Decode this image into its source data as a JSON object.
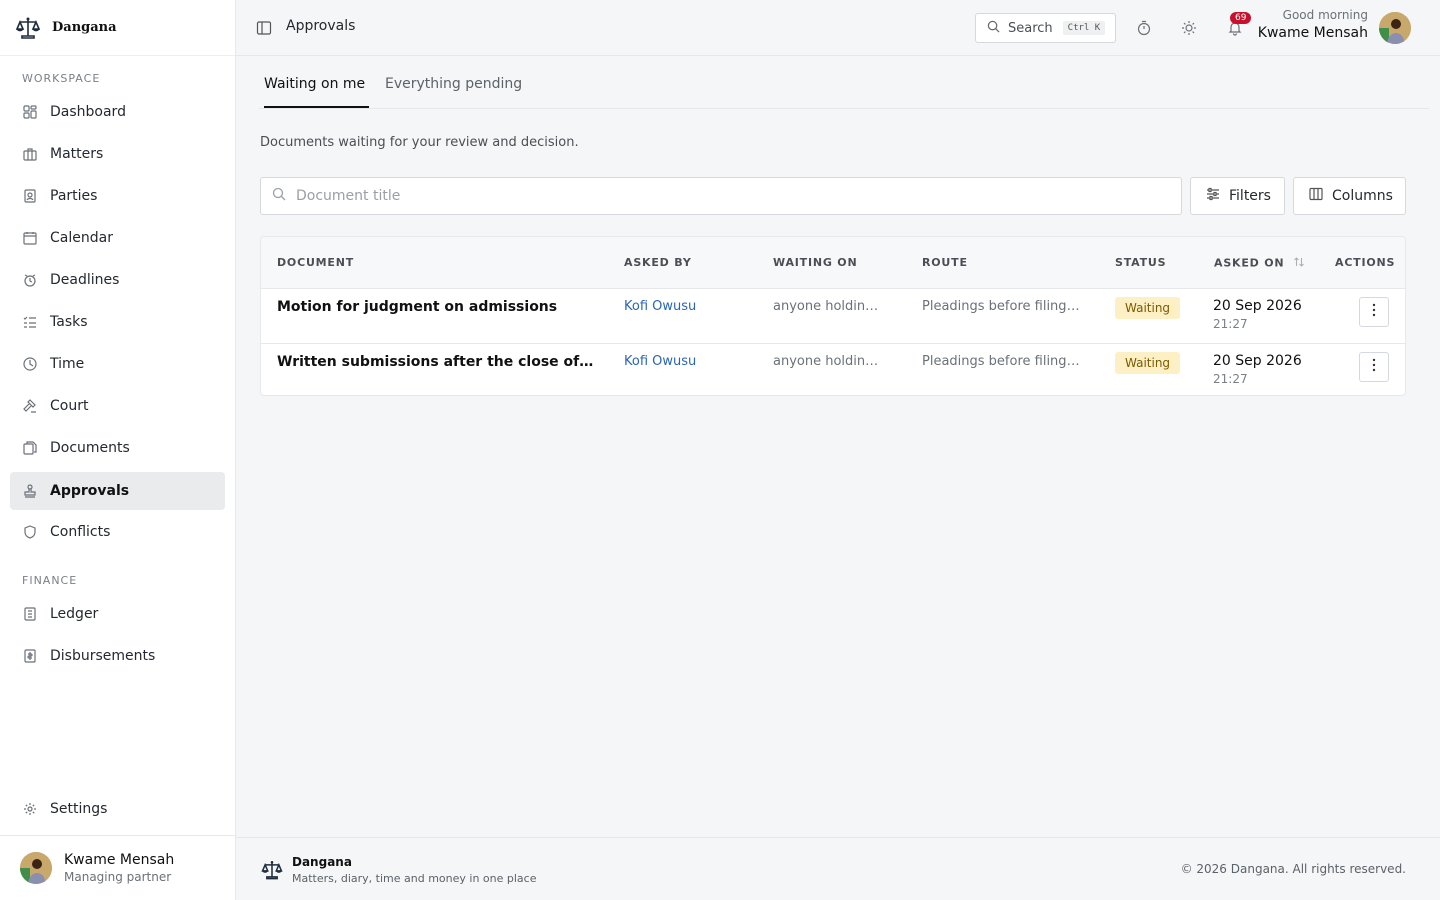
{
  "app": {
    "name": "Dangana",
    "tagline": "Matters, diary, time and money in one place",
    "copyright": "© 2026 Dangana. All rights reserved."
  },
  "sidebar": {
    "sections": [
      {
        "label": "WORKSPACE"
      },
      {
        "label": "FINANCE"
      }
    ],
    "items": [
      {
        "label": "Dashboard",
        "icon": "dashboard-icon"
      },
      {
        "label": "Matters",
        "icon": "briefcase-icon"
      },
      {
        "label": "Parties",
        "icon": "contact-card-icon"
      },
      {
        "label": "Calendar",
        "icon": "calendar-icon"
      },
      {
        "label": "Deadlines",
        "icon": "alarm-clock-icon"
      },
      {
        "label": "Tasks",
        "icon": "task-list-icon"
      },
      {
        "label": "Time",
        "icon": "clock-icon"
      },
      {
        "label": "Court",
        "icon": "gavel-icon"
      },
      {
        "label": "Documents",
        "icon": "documents-icon"
      },
      {
        "label": "Approvals",
        "icon": "stamp-icon",
        "active": true
      },
      {
        "label": "Conflicts",
        "icon": "shield-icon"
      },
      {
        "label": "Ledger",
        "icon": "ledger-icon"
      },
      {
        "label": "Disbursements",
        "icon": "receipt-icon"
      }
    ],
    "settings": {
      "label": "Settings",
      "icon": "gear-icon"
    },
    "user": {
      "name": "Kwame Mensah",
      "role": "Managing partner"
    }
  },
  "header": {
    "title": "Approvals",
    "search": {
      "label": "Search",
      "shortcut": "Ctrl K"
    },
    "notifications": {
      "count": "69"
    },
    "greeting": "Good morning",
    "user_name": "Kwame Mensah"
  },
  "tabs": [
    {
      "label": "Waiting on me",
      "active": true
    },
    {
      "label": "Everything pending",
      "active": false
    }
  ],
  "main": {
    "description": "Documents waiting for your review and decision.",
    "search_placeholder": "Document title",
    "filters_label": "Filters",
    "columns_label": "Columns"
  },
  "table": {
    "headers": {
      "document": "DOCUMENT",
      "asked_by": "ASKED BY",
      "waiting_on": "WAITING ON",
      "route": "ROUTE",
      "status": "STATUS",
      "asked_on": "ASKED ON",
      "actions": "ACTIONS"
    },
    "rows": [
      {
        "document": "Motion for judgment on admissions",
        "asked_by": "Kofi Owusu",
        "waiting_on": "anyone holding …",
        "route": "Pleadings before filing · …",
        "status": "Waiting",
        "date": "20 Sep 2026",
        "time": "21:27"
      },
      {
        "document": "Written submissions after the close of eviden…",
        "asked_by": "Kofi Owusu",
        "waiting_on": "anyone holding …",
        "route": "Pleadings before filing · …",
        "status": "Waiting",
        "date": "20 Sep 2026",
        "time": "21:27"
      }
    ]
  },
  "colors": {
    "status_bg": "#fdf0c4",
    "link": "#2a64b8",
    "badge": "#c8102e",
    "active_nav": "#e9ebed"
  }
}
